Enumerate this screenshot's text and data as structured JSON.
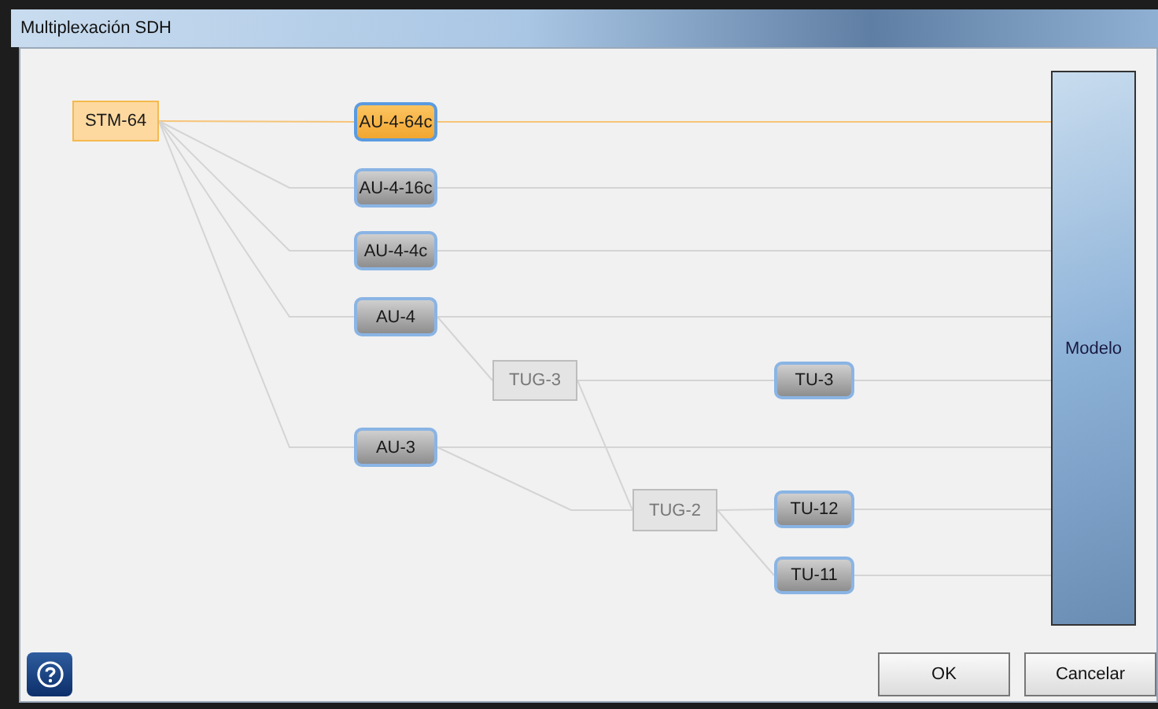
{
  "window": {
    "title": "Multiplexación SDH"
  },
  "diagram": {
    "nodes": [
      {
        "label": "STM-64",
        "kind": "source",
        "selected": false
      },
      {
        "label": "AU-4-64c",
        "kind": "container",
        "selected": true
      },
      {
        "label": "AU-4-16c",
        "kind": "container",
        "selected": false
      },
      {
        "label": "AU-4-4c",
        "kind": "container",
        "selected": false
      },
      {
        "label": "AU-4",
        "kind": "container",
        "selected": false
      },
      {
        "label": "AU-3",
        "kind": "container",
        "selected": false
      },
      {
        "label": "TUG-3",
        "kind": "group",
        "selected": false
      },
      {
        "label": "TUG-2",
        "kind": "group",
        "selected": false
      },
      {
        "label": "TU-3",
        "kind": "container",
        "selected": false
      },
      {
        "label": "TU-12",
        "kind": "container",
        "selected": false
      },
      {
        "label": "TU-11",
        "kind": "container",
        "selected": false
      }
    ],
    "target": {
      "label": "Modelo"
    }
  },
  "buttons": [
    "OK",
    "Cancelar"
  ]
}
